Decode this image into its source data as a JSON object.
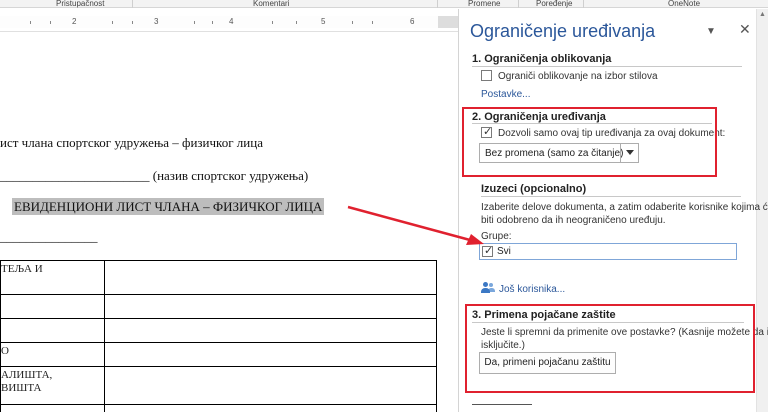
{
  "ribbon": {
    "groups": [
      "Pristupačnost",
      "Komentari",
      "Promene",
      "Poređenje",
      "OneNote"
    ]
  },
  "ruler": {
    "numbers": [
      "2",
      "3",
      "4",
      "5",
      "6"
    ]
  },
  "document": {
    "line1": "ист члана спортског удружења  – физичког лица",
    "line2": "_______________________ (назив спортског удружења)",
    "heading": "ЕВИДЕНЦИОНИ ЛИСТ ЧЛАНА – ФИЗИЧКОГ ЛИЦА",
    "underline": "_______________",
    "table_rows": [
      [
        "ТЕЉА И",
        ""
      ],
      [
        "",
        ""
      ],
      [
        "",
        ""
      ],
      [
        "О",
        ""
      ],
      [
        "АЛИШТА,\nВИШТА",
        ""
      ],
      [
        "",
        ""
      ]
    ]
  },
  "pane": {
    "title": "Ograničenje uređivanja",
    "section1": {
      "heading": "1. Ograničenja oblikovanja",
      "checkbox_label": "Ograniči oblikovanje na izbor stilova",
      "checked": false,
      "link": "Postavke..."
    },
    "section2": {
      "heading": "2. Ograničenja uređivanja",
      "checkbox_label": "Dozvoli samo ovaj tip uređivanja za ovaj dokument:",
      "checked": true,
      "dropdown_value": "Bez promena (samo za čitanje)"
    },
    "exceptions": {
      "heading": "Izuzeci (opcionalno)",
      "description_line1": "Izaberite delove dokumenta, a zatim odaberite korisnike kojima će",
      "description_line2": "biti odobreno da ih neograničeno uređuju.",
      "groups_label": "Grupe:",
      "group_item": "Svi",
      "group_checked": true,
      "more_users_link": "Još korisnika..."
    },
    "section3": {
      "heading": "3. Primena pojačane zaštite",
      "question_line1": "Jeste li spremni da primenite ove postavke? (Kasnije možete da ih",
      "question_line2": "isključite.)",
      "button_label": "Da, primeni pojačanu zaštitu"
    }
  },
  "colors": {
    "accent": "#2b579a",
    "annotation_red": "#e0212f"
  }
}
